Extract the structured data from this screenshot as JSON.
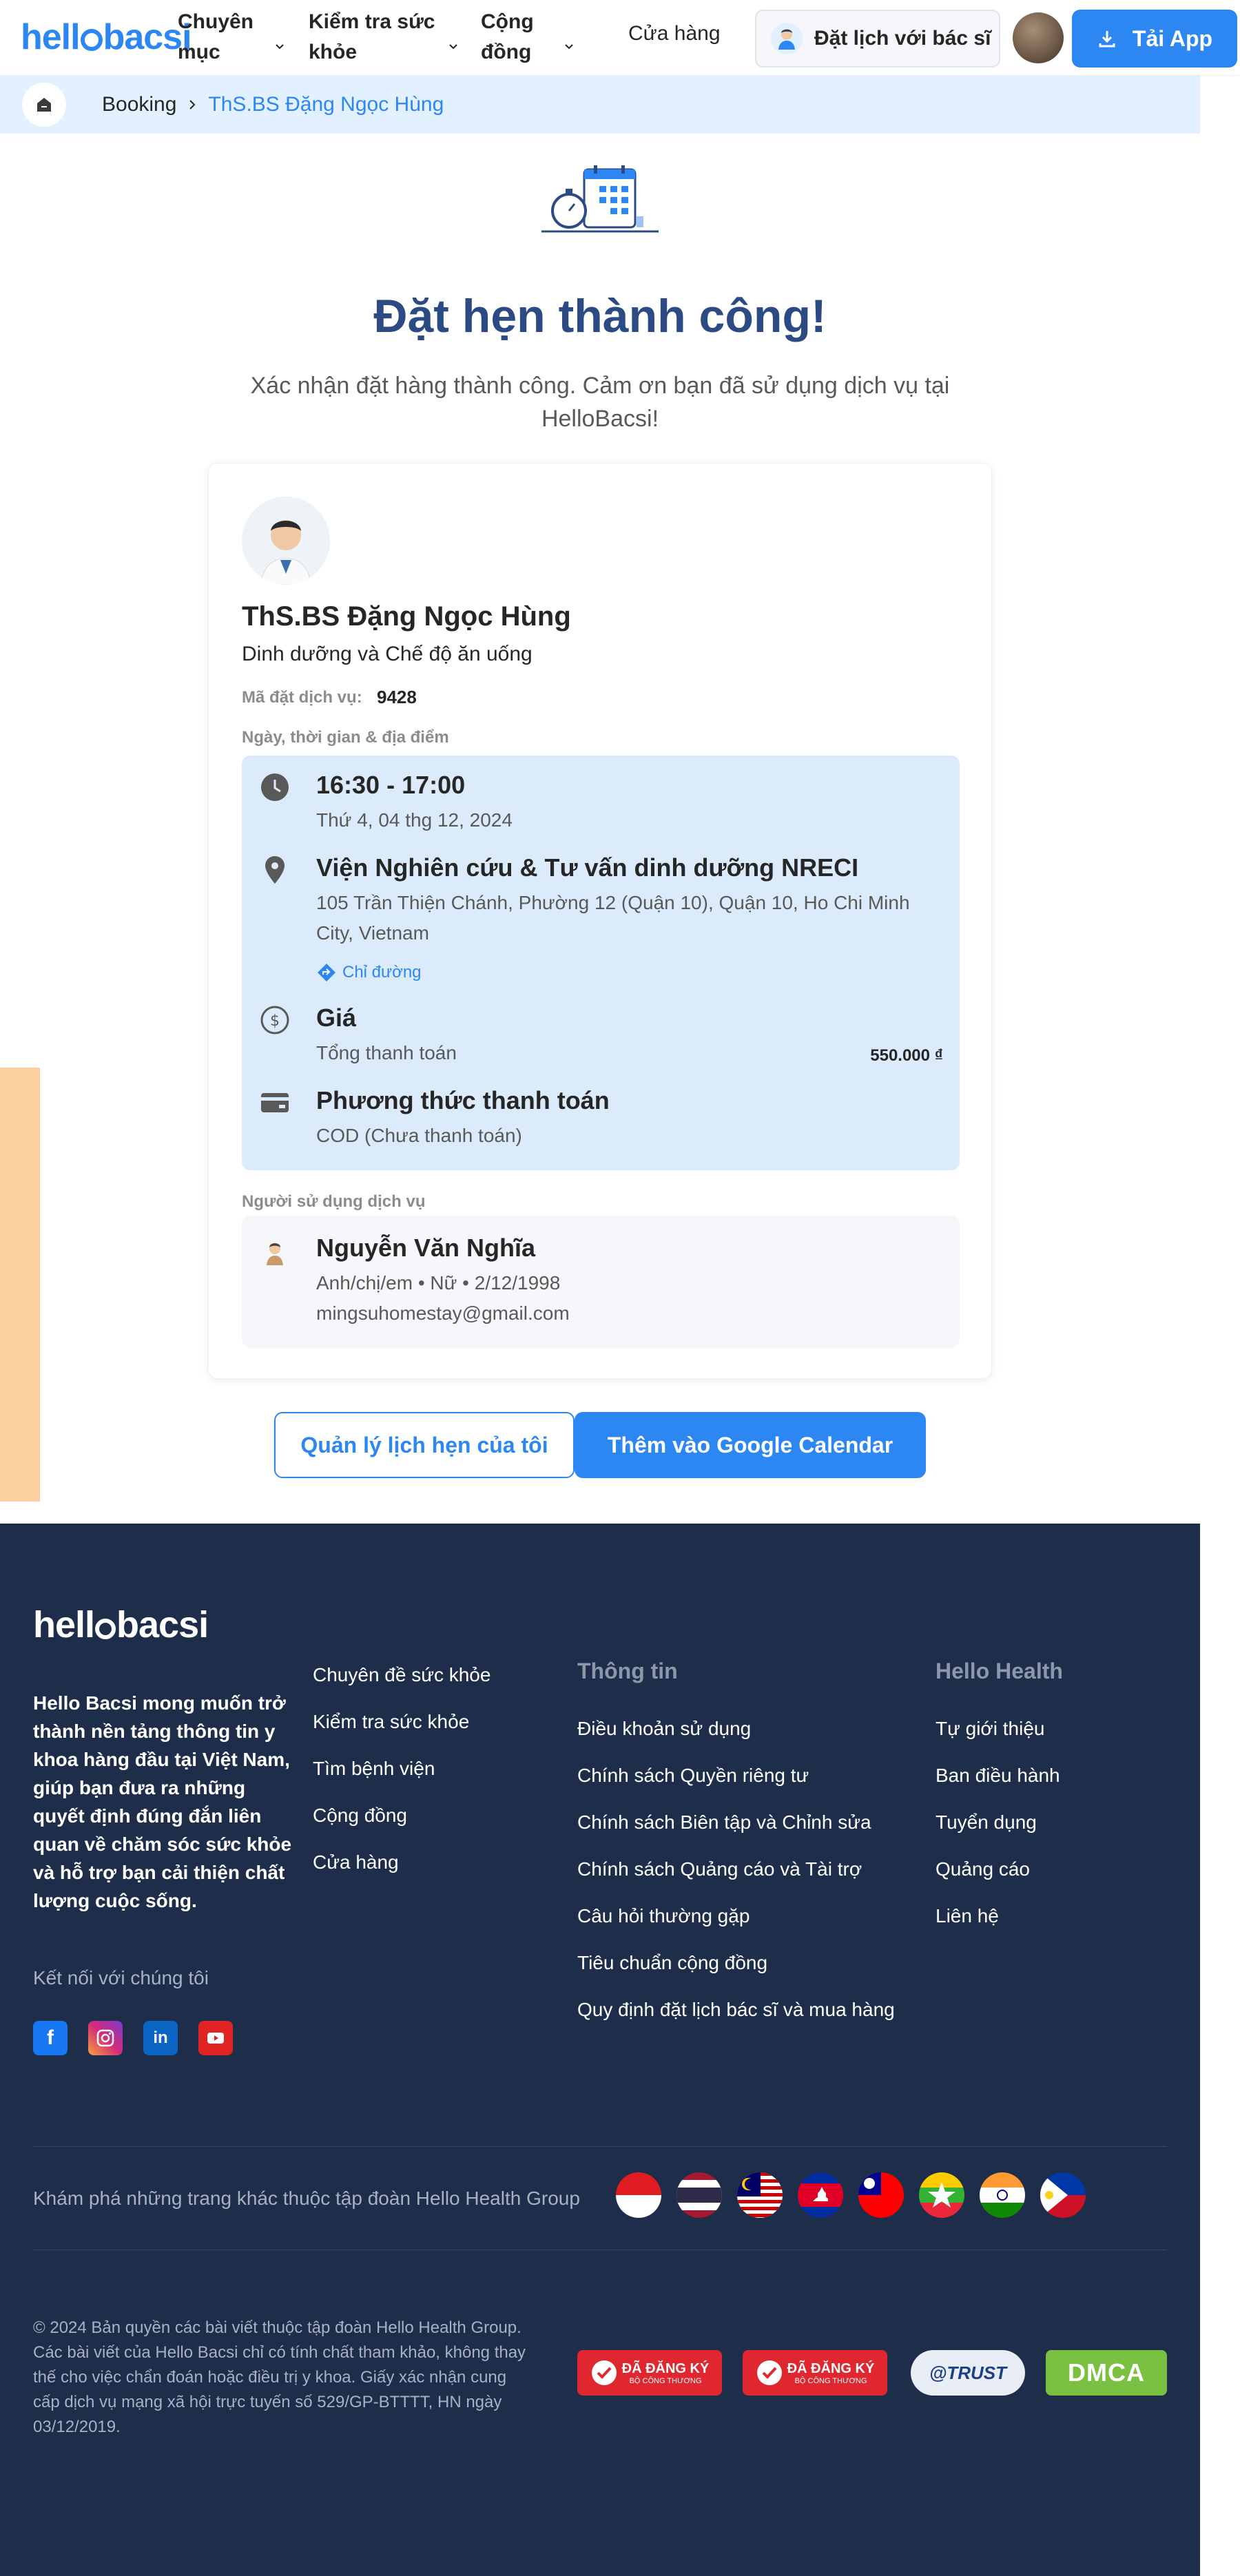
{
  "header": {
    "logo_text_a": "hell",
    "logo_text_b": "bacsi",
    "nav": [
      {
        "label_line1": "Chuyên",
        "label_line2": "mục"
      },
      {
        "label_line1": "Kiểm tra sức",
        "label_line2": "khỏe"
      },
      {
        "label_line1": "Cộng",
        "label_line2": "đồng"
      }
    ],
    "shop": "Cửa hàng",
    "book_doctor": "Đặt lịch với bác sĩ",
    "app_button": "Tải App"
  },
  "breadcrumb": {
    "root": "Booking",
    "current": "ThS.BS Đặng Ngọc Hùng"
  },
  "hero": {
    "title": "Đặt hẹn thành công!",
    "subtitle": "Xác nhận đặt hàng thành công. Cảm ơn bạn đã sử dụng dịch vụ tại HelloBacsi!"
  },
  "booking": {
    "doctor_name": "ThS.BS Đặng Ngọc Hùng",
    "specialty": "Dinh dưỡng và Chế độ ăn uống",
    "code_label": "Mã đặt dịch vụ:",
    "code_value": "9428",
    "schedule_label": "Ngày, thời gian & địa điểm",
    "time": "16:30 - 17:00",
    "date": "Thứ 4, 04 thg 12, 2024",
    "place_name": "Viện Nghiên cứu & Tư vấn dinh dưỡng NRECI",
    "address_line1": "105 Trần Thiện Chánh, Phường 12 (Quận 10), Quận 10, Ho Chi Minh",
    "address_line2": "City, Vietnam",
    "directions": "Chỉ đường",
    "price_title": "Giá",
    "price_label": "Tổng thanh toán",
    "price_value": "550.000 ₫",
    "payment_title": "Phương thức thanh toán",
    "payment_value": "COD (Chưa thanh toán)",
    "user_label": "Người sử dụng dịch vụ",
    "user_name": "Nguyễn Văn Nghĩa",
    "user_info": "Anh/chị/em • Nữ • 2/12/1998",
    "user_email": "mingsuhomestay@gmail.com"
  },
  "actions": {
    "manage": "Quản lý lịch hẹn của tôi",
    "calendar": "Thêm vào Google Calendar"
  },
  "footer": {
    "logo_text_a": "hell",
    "logo_text_b": "bacsi",
    "about": "Hello Bacsi mong muốn trở thành nền tảng thông tin y khoa hàng đầu tại Việt Nam, giúp bạn đưa ra những quyết định đúng đắn liên quan về chăm sóc sức khỏe và hỗ trợ bạn cải thiện chất lượng cuộc sống.",
    "connect": "Kết nối với chúng tôi",
    "col1": [
      "Chuyên đề sức khỏe",
      "Kiểm tra sức khỏe",
      "Tìm bệnh viện",
      "Cộng đồng",
      "Cửa hàng"
    ],
    "col2_title": "Thông tin",
    "col2": [
      "Điều khoản sử dụng",
      "Chính sách Quyền riêng tư",
      "Chính sách Biên tập và Chỉnh sửa",
      "Chính sách Quảng cáo và Tài trợ",
      "Câu hỏi thường gặp",
      "Tiêu chuẩn cộng đồng",
      "Quy định đặt lịch bác sĩ và mua hàng"
    ],
    "col3_title": "Hello Health",
    "col3": [
      "Tự giới thiệu",
      "Ban điều hành",
      "Tuyển dụng",
      "Quảng cáo",
      "Liên hệ"
    ],
    "explore": "Khám phá những trang khác thuộc tập đoàn Hello Health Group",
    "copyright": "© 2024 Bản quyền các bài viết thuộc tập đoàn Hello Health Group. Các bài viết của Hello Bacsi chỉ có tính chất tham khảo, không thay thế cho việc chẩn đoán hoặc điều trị y khoa. Giấy xác nhận cung cấp dịch vụ mạng xã hội trực tuyến số 529/GP-BTTTT, HN ngày 03/12/2019.",
    "cert_registered": "ĐÃ ĐĂNG KÝ",
    "cert_registered_sub": "BỘ CÔNG THƯƠNG",
    "cert_trust": "@TRUST",
    "cert_dmca": "DMCA"
  },
  "colors": {
    "primary": "#2d87f3",
    "title": "#2c4b84",
    "footer_bg": "#1e2d4a",
    "info_bg": "#dcebfc"
  }
}
